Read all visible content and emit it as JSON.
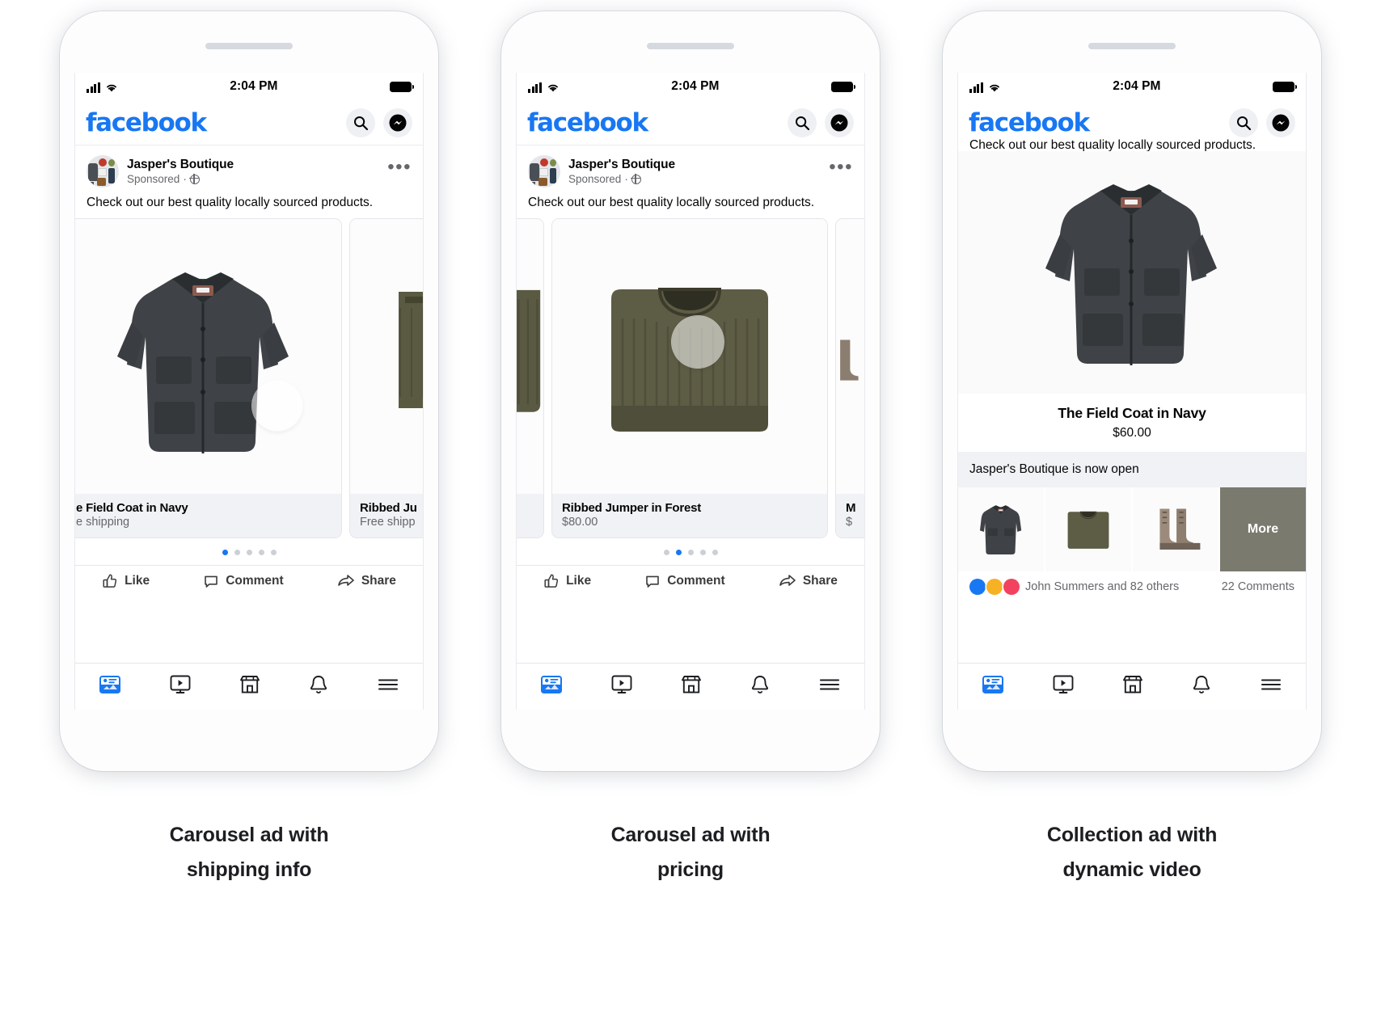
{
  "theme": {
    "brand_blue": "#1877F2",
    "text_primary": "#050505",
    "text_secondary": "#65676b",
    "card_bg": "#f0f2f5"
  },
  "status_bar": {
    "time": "2:04 PM",
    "signal_icon": "cellular-bars-icon",
    "wifi_icon": "wifi-icon",
    "battery_icon": "battery-full-icon"
  },
  "app_bar": {
    "logo_text": "facebook",
    "search_icon": "search-icon",
    "messenger_icon": "messenger-icon"
  },
  "post": {
    "page_name": "Jasper's Boutique",
    "sponsored_label": "Sponsored",
    "separator": "·",
    "audience_icon": "globe-icon",
    "menu_icon": "more-options-icon",
    "body_text": "Check out our best quality locally sourced products.",
    "avatar_icon": "page-avatar"
  },
  "actions": {
    "like": "Like",
    "comment": "Comment",
    "share": "Share",
    "like_icon": "thumbs-up-icon",
    "comment_icon": "comment-bubble-icon",
    "share_icon": "share-arrow-icon"
  },
  "nav": {
    "items": [
      {
        "name": "news-feed",
        "icon": "news-feed-icon",
        "active": true
      },
      {
        "name": "watch",
        "icon": "watch-play-icon",
        "active": false
      },
      {
        "name": "marketplace",
        "icon": "marketplace-shop-icon",
        "active": false
      },
      {
        "name": "notifications",
        "icon": "bell-icon",
        "active": false
      },
      {
        "name": "menu",
        "icon": "hamburger-menu-icon",
        "active": false
      }
    ]
  },
  "phone1": {
    "caption_line1": "Carousel ad with",
    "caption_line2": "shipping info",
    "cards": [
      {
        "title": "e Field Coat in Navy",
        "sub": "e shipping",
        "product": "field-coat"
      },
      {
        "title": "Ribbed Ju",
        "sub": "Free shipp",
        "product": "ribbed-jumper"
      }
    ],
    "pagination": {
      "count": 5,
      "active_index": 0
    }
  },
  "phone2": {
    "caption_line1": "Carousel ad with",
    "caption_line2": "pricing",
    "cards": [
      {
        "title": "",
        "sub": "",
        "product": "field-coat-edge"
      },
      {
        "title": "Ribbed Jumper in Forest",
        "sub": "$80.00",
        "product": "ribbed-jumper"
      },
      {
        "title": "M",
        "sub": "$",
        "product": "boots"
      }
    ],
    "pagination": {
      "count": 5,
      "active_index": 1
    }
  },
  "phone3": {
    "caption_line1": "Collection ad with",
    "caption_line2": "dynamic video",
    "clipped_post_text": "Check out our best quality locally sourced products.",
    "hero": {
      "title": "The Field Coat in Navy",
      "price": "$60.00",
      "product": "field-coat"
    },
    "now_open_text": "Jasper's Boutique is now open",
    "thumbnails": [
      {
        "product": "field-coat",
        "label": ""
      },
      {
        "product": "ribbed-jumper",
        "label": ""
      },
      {
        "product": "boots",
        "label": ""
      },
      {
        "product": "trousers",
        "label": "More"
      }
    ],
    "reactions": {
      "icons": [
        "like-reaction-icon",
        "haha-reaction-icon",
        "love-reaction-icon"
      ],
      "summary": "John Summers and 82 others",
      "comments": "22 Comments"
    }
  }
}
